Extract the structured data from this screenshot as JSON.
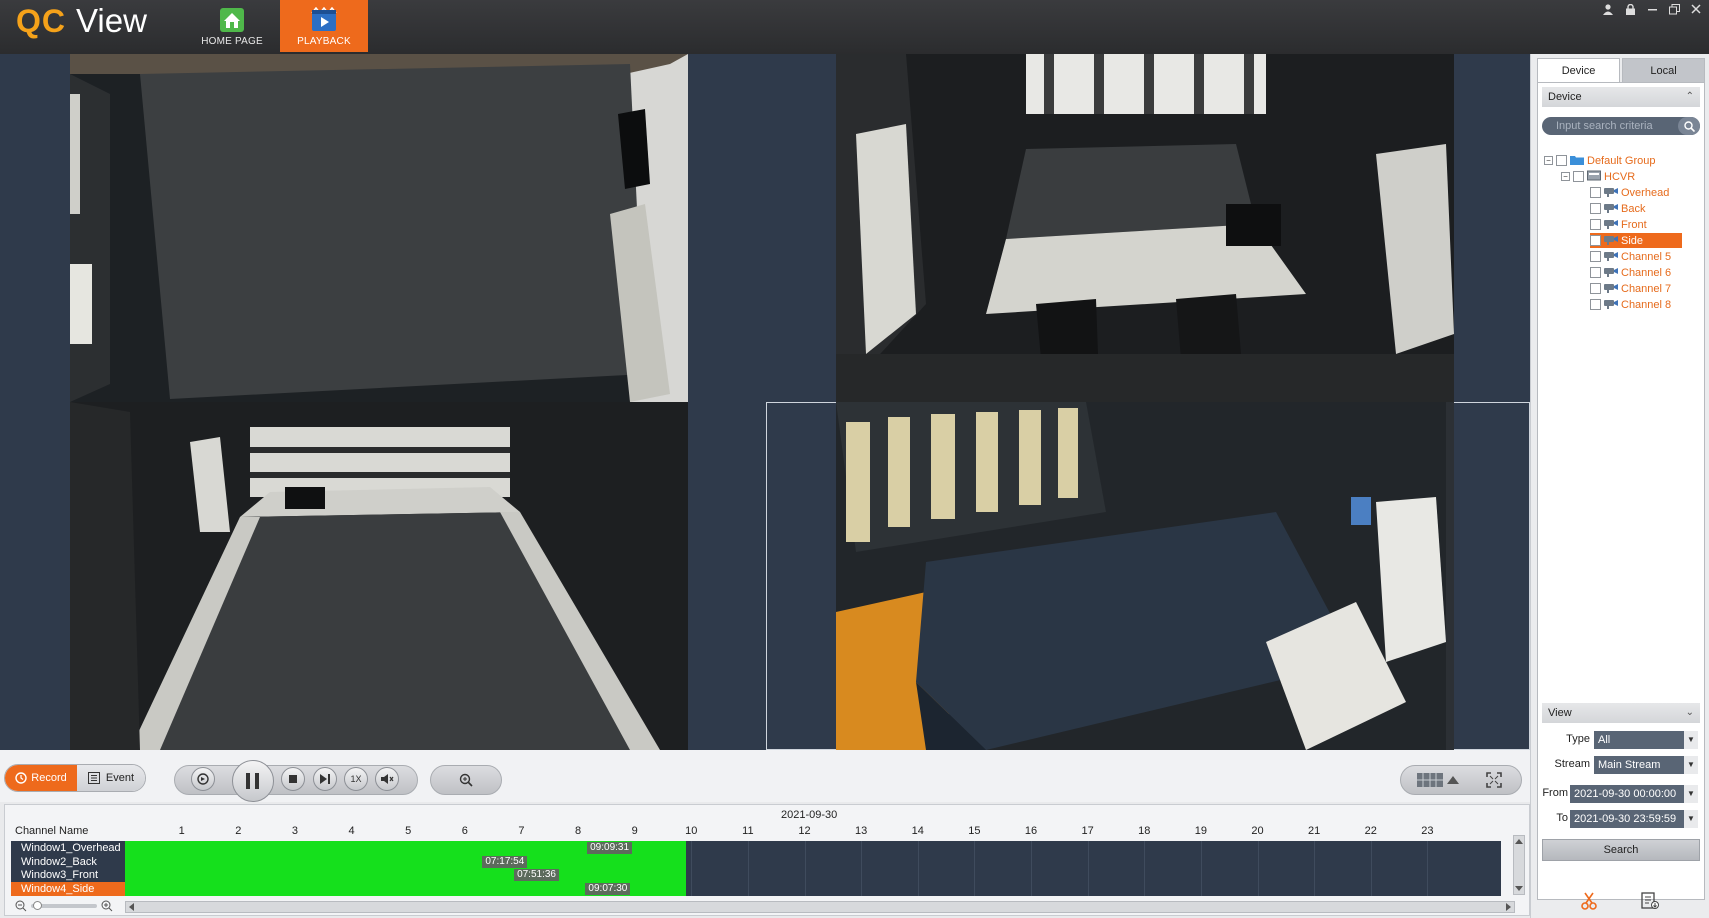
{
  "app": {
    "logo_qc": "QC",
    "logo_view": "View"
  },
  "nav": {
    "home_label": "HOME PAGE",
    "playback_label": "PLAYBACK"
  },
  "controls": {
    "record_label": "Record",
    "event_label": "Event",
    "speed_label": "1X"
  },
  "timeline": {
    "channel_header": "Channel Name",
    "date": "2021-09-30",
    "hours": [
      "1",
      "2",
      "3",
      "4",
      "5",
      "6",
      "7",
      "8",
      "9",
      "10",
      "11",
      "12",
      "13",
      "14",
      "15",
      "16",
      "17",
      "18",
      "19",
      "20",
      "21",
      "22",
      "23"
    ],
    "rows": [
      {
        "name": "Window1_Overhead",
        "stamp": "09:09:31",
        "selected": false
      },
      {
        "name": "Window2_Back",
        "stamp": "07:17:54",
        "selected": false
      },
      {
        "name": "Window3_Front",
        "stamp": "07:51:36",
        "selected": false
      },
      {
        "name": "Window4_Side",
        "stamp": "09:07:30",
        "selected": true
      }
    ],
    "recorded_until_hour": 9.9
  },
  "side": {
    "tab_device": "Device",
    "tab_local": "Local",
    "device_header": "Device",
    "search_placeholder": "Input search criteria",
    "tree": {
      "group": "Default Group",
      "device": "HCVR",
      "channels": [
        {
          "label": "Overhead",
          "selected": false
        },
        {
          "label": "Back",
          "selected": false
        },
        {
          "label": "Front",
          "selected": false
        },
        {
          "label": "Side",
          "selected": true
        },
        {
          "label": "Channel 5",
          "selected": false
        },
        {
          "label": "Channel 6",
          "selected": false
        },
        {
          "label": "Channel 7",
          "selected": false
        },
        {
          "label": "Channel 8",
          "selected": false
        }
      ]
    },
    "view_header": "View",
    "type_label": "Type",
    "type_value": "All",
    "stream_label": "Stream",
    "stream_value": "Main Stream",
    "from_label": "From",
    "from_value": "2021-09-30 00:00:00",
    "to_label": "To",
    "to_value": "2021-09-30 23:59:59",
    "search_button": "Search"
  },
  "colors": {
    "accent": "#ee6a1c",
    "record_green": "#15e01c",
    "video_bg": "#2f3a4b"
  }
}
